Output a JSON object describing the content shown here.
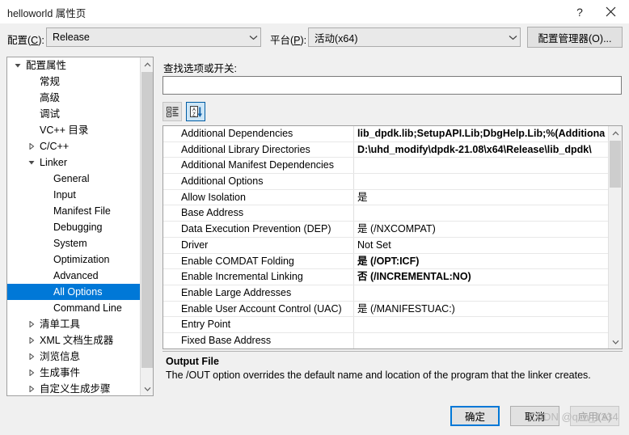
{
  "window": {
    "title": "helloworld 属性页",
    "help_label": "?",
    "close_label": "×"
  },
  "config_bar": {
    "configuration_label_pre": "配置(",
    "configuration_label_key": "C",
    "configuration_label_post": "):",
    "configuration_value": "Release",
    "platform_label_pre": "平台(",
    "platform_label_key": "P",
    "platform_label_post": "):",
    "platform_value": "活动(x64)",
    "config_manager_button": "配置管理器(O)...",
    "chevron_icon": "chevron-down-icon"
  },
  "tree": {
    "items": [
      {
        "label": "配置属性",
        "level": 0,
        "arrow": "expanded",
        "selected": false
      },
      {
        "label": "常规",
        "level": 1,
        "arrow": "none",
        "selected": false
      },
      {
        "label": "高级",
        "level": 1,
        "arrow": "none",
        "selected": false
      },
      {
        "label": "调试",
        "level": 1,
        "arrow": "none",
        "selected": false
      },
      {
        "label": "VC++ 目录",
        "level": 1,
        "arrow": "none",
        "selected": false
      },
      {
        "label": "C/C++",
        "level": 1,
        "arrow": "collapsed",
        "selected": false
      },
      {
        "label": "Linker",
        "level": 1,
        "arrow": "expanded",
        "selected": false
      },
      {
        "label": "General",
        "level": 2,
        "arrow": "none",
        "selected": false
      },
      {
        "label": "Input",
        "level": 2,
        "arrow": "none",
        "selected": false
      },
      {
        "label": "Manifest File",
        "level": 2,
        "arrow": "none",
        "selected": false
      },
      {
        "label": "Debugging",
        "level": 2,
        "arrow": "none",
        "selected": false
      },
      {
        "label": "System",
        "level": 2,
        "arrow": "none",
        "selected": false
      },
      {
        "label": "Optimization",
        "level": 2,
        "arrow": "none",
        "selected": false
      },
      {
        "label": "Advanced",
        "level": 2,
        "arrow": "none",
        "selected": false
      },
      {
        "label": "All Options",
        "level": 2,
        "arrow": "none",
        "selected": true
      },
      {
        "label": "Command Line",
        "level": 2,
        "arrow": "none",
        "selected": false
      },
      {
        "label": "清单工具",
        "level": 1,
        "arrow": "collapsed",
        "selected": false
      },
      {
        "label": "XML 文档生成器",
        "level": 1,
        "arrow": "collapsed",
        "selected": false
      },
      {
        "label": "浏览信息",
        "level": 1,
        "arrow": "collapsed",
        "selected": false
      },
      {
        "label": "生成事件",
        "level": 1,
        "arrow": "collapsed",
        "selected": false
      },
      {
        "label": "自定义生成步骤",
        "level": 1,
        "arrow": "collapsed",
        "selected": false
      }
    ]
  },
  "search": {
    "label": "查找选项或开关:",
    "value": "",
    "placeholder": ""
  },
  "grid_toolbar": {
    "categorized_icon": "categorized-view-icon",
    "alphabetical_icon": "sort-alphabetical-icon",
    "alphabetical_active": true
  },
  "grid": {
    "rows": [
      {
        "name": "Additional Dependencies",
        "value": "lib_dpdk.lib;SetupAPI.Lib;DbgHelp.Lib;%(Additiona",
        "bold": true
      },
      {
        "name": "Additional Library Directories",
        "value": "D:\\uhd_modify\\dpdk-21.08\\x64\\Release\\lib_dpdk\\",
        "bold": true
      },
      {
        "name": "Additional Manifest Dependencies",
        "value": "",
        "bold": false
      },
      {
        "name": "Additional Options",
        "value": "",
        "bold": false
      },
      {
        "name": "Allow Isolation",
        "value": "是",
        "bold": false
      },
      {
        "name": "Base Address",
        "value": "",
        "bold": false
      },
      {
        "name": "Data Execution Prevention (DEP)",
        "value": "是 (/NXCOMPAT)",
        "bold": false
      },
      {
        "name": "Driver",
        "value": "Not Set",
        "bold": false
      },
      {
        "name": "Enable COMDAT Folding",
        "value": "是 (/OPT:ICF)",
        "bold": true
      },
      {
        "name": "Enable Incremental Linking",
        "value": "否 (/INCREMENTAL:NO)",
        "bold": true
      },
      {
        "name": "Enable Large Addresses",
        "value": "",
        "bold": false
      },
      {
        "name": "Enable User Account Control (UAC)",
        "value": "是 (/MANIFESTUAC:)",
        "bold": false
      },
      {
        "name": "Entry Point",
        "value": "",
        "bold": false
      },
      {
        "name": "Fixed Base Address",
        "value": "",
        "bold": false
      }
    ]
  },
  "description": {
    "title": "Output File",
    "body": "The /OUT option overrides the default name and location of the program that the linker creates."
  },
  "footer": {
    "ok_label": "确定",
    "cancel_label": "取消",
    "apply_label": "应用(A)",
    "apply_disabled": true
  },
  "watermark": "CSDN @qzh_1234",
  "colors": {
    "accent": "#0078d7",
    "dialog_bg": "#f0f0f0",
    "field_bg": "#ffffff"
  }
}
